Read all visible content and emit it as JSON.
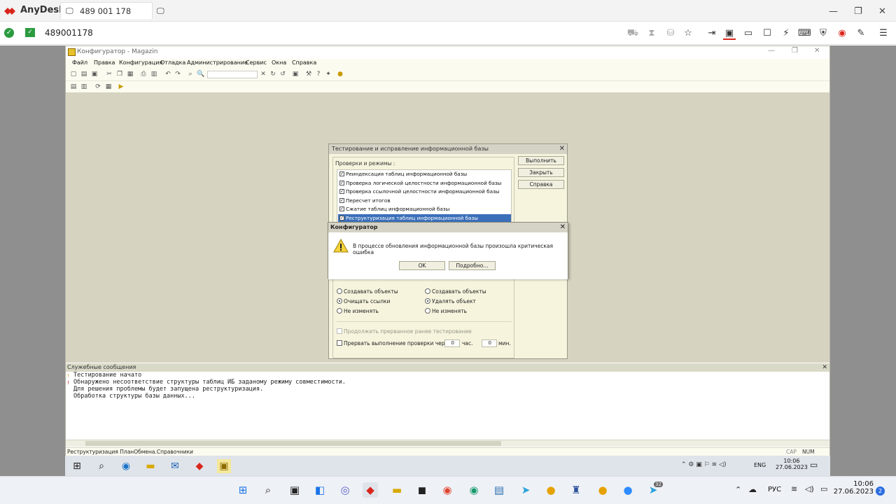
{
  "anydesk": {
    "app_name": "AnyDesk",
    "tab_label": "489 001 178",
    "address": "489001178",
    "colors": {
      "brand": "#d9261c",
      "ok": "#2a9b3f"
    }
  },
  "configurator": {
    "title": "Конфигуратор - Magazin",
    "menu": [
      "Файл",
      "Правка",
      "Конфигурация",
      "Отладка",
      "Администрирование",
      "Сервис",
      "Окна",
      "Справка"
    ],
    "messages": {
      "title": "Служебные сообщения",
      "lines": [
        "Тестирование начато",
        "Обнаружено несоответствие структуры таблиц ИБ заданому режиму совместимости.",
        "Для решения проблемы будет запущена реструктуризация.",
        "Обработка структуры базы данных..."
      ]
    },
    "status": {
      "text": "Реструктуризация ПланОбмена.Справочники",
      "cap": "CAP",
      "num": "NUM"
    }
  },
  "test_dialog": {
    "title": "Тестирование и исправление информационной базы",
    "group_label": "Проверки и режимы :",
    "checks": [
      "Реиндексация таблиц информационной базы",
      "Проверка логической целостности информационной базы",
      "Проверка ссылочной целостности информационной базы",
      "Пересчет итогов",
      "Сжатие таблиц информационной базы",
      "Реструктуризация таблиц информационной базы"
    ],
    "buttons": {
      "run": "Выполнить",
      "close": "Закрыть",
      "help": "Справка"
    },
    "radios_left": [
      "Создавать объекты",
      "Очищать ссылки",
      "Не изменять"
    ],
    "radios_right": [
      "Создавать объекты",
      "Удалять объект",
      "Не изменять"
    ],
    "continue_label": "Продолжить прерванное ранее тестирование",
    "interrupt_label": "Прервать выполнение проверки чер...",
    "hours_value": "0",
    "hours_unit": "час.",
    "minutes_value": "0",
    "minutes_unit": "мин."
  },
  "alert": {
    "title": "Конфигуратор",
    "message": "В процессе обновления информационной базы произошла критическая ошибка",
    "ok": "OK",
    "details": "Подробно..."
  },
  "remote_taskbar": {
    "lang": "ENG",
    "time": "10:06",
    "date": "27.06.2023"
  },
  "taskbar": {
    "lang": "РУС",
    "time": "10:06",
    "date": "27.06.2023",
    "badge": "2",
    "telegram_badge": "32"
  }
}
